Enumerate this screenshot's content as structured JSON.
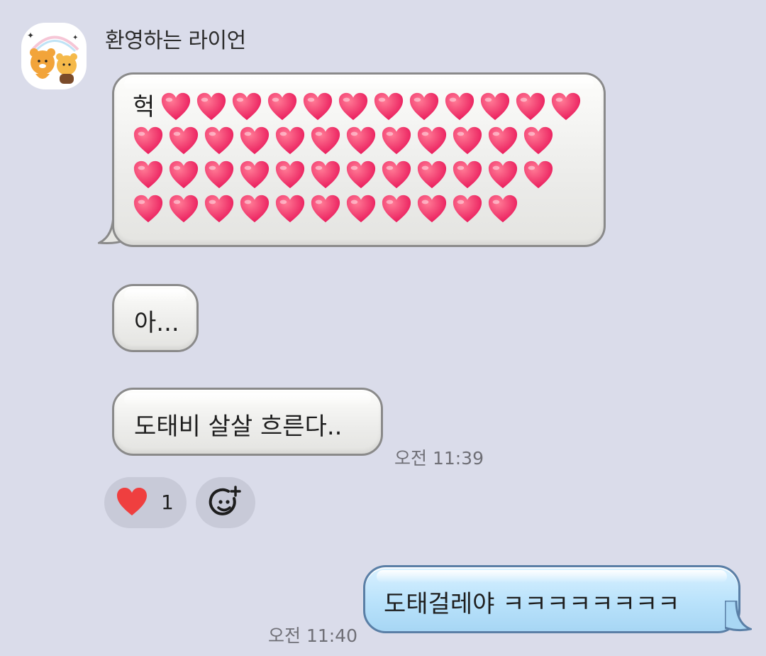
{
  "sender": {
    "name": "환영하는 라이언"
  },
  "messages": [
    {
      "from": "other",
      "text_prefix": "헉",
      "heart_emoji_count": 47
    },
    {
      "from": "other",
      "text": "아..."
    },
    {
      "from": "other",
      "text": "도태비 살살 흐른다..",
      "time": "오전 11:39"
    },
    {
      "from": "me",
      "text": "도태걸레야 ㅋㅋㅋㅋㅋㅋㅋㅋ",
      "time": "오전 11:40"
    }
  ],
  "reaction": {
    "icon": "red-heart-icon",
    "count": "1"
  },
  "add_reaction_icon": "add-emoji-icon",
  "colors": {
    "background": "#dadcea",
    "heart": "#f0405f",
    "my_bubble": "#b9e2fb",
    "other_bubble": "#ececea"
  }
}
